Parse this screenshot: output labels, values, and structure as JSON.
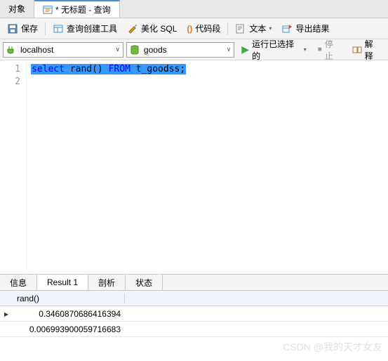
{
  "tabs": {
    "object": "对象",
    "query_title": "* 无标题 - 查询"
  },
  "toolbar": {
    "save": "保存",
    "query_builder": "查询创建工具",
    "beautify": "美化 SQL",
    "snippet": "代码段",
    "text": "文本",
    "export": "导出结果"
  },
  "connection": {
    "host": "localhost",
    "db": "goods",
    "run": "运行已选择的",
    "stop": "停止",
    "explain": "解释"
  },
  "editor": {
    "lines": [
      "1",
      "2"
    ],
    "sql": {
      "kw1": "select",
      "fn": "rand()",
      "kw2": "FROM",
      "tbl": "t_goodss;"
    }
  },
  "bottom_tabs": {
    "info": "信息",
    "result": "Result 1",
    "profile": "剖析",
    "status": "状态"
  },
  "result": {
    "column": "rand()",
    "rows": [
      "0.3460870686416394",
      "0.006993900059716683"
    ]
  },
  "watermark": "CSDN @我的天才女友"
}
